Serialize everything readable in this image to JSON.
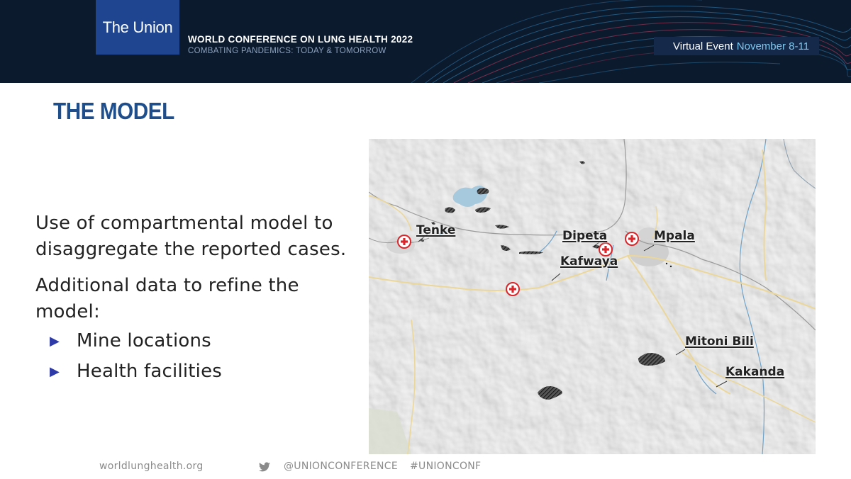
{
  "header": {
    "logo_text": "The Union",
    "conference_title": "WORLD CONFERENCE ON LUNG HEALTH 2022",
    "conference_subtitle": "COMBATING PANDEMICS: TODAY & TOMORROW",
    "event_label": "Virtual Event",
    "event_dates": "November 8-11",
    "colors": {
      "banner_bg": "#0c1a2e",
      "logo_bg": "#1f4590",
      "dates_accent": "#7fc7ee"
    }
  },
  "slide": {
    "title": "THE MODEL",
    "paragraph_1": "Use of compartmental model to disaggregate the reported cases.",
    "paragraph_2": "Additional data to refine the model:",
    "bullets": [
      "Mine locations",
      "Health facilities"
    ],
    "title_color": "#1f4e8c",
    "bullet_color": "#2d3aa8"
  },
  "map": {
    "towns": [
      "Tenke",
      "Dipeta",
      "Mpala",
      "Kafwaya",
      "Mitoni Bili",
      "Kakanda"
    ],
    "health_facility_icon": "red-cross-icon",
    "mine_icon": "hatched-mine-area",
    "health_facility_color": "#d9262b"
  },
  "footer": {
    "website": "worldlunghealth.org",
    "twitter_icon": "twitter-icon",
    "twitter_handle": "@UNIONCONFERENCE",
    "hashtag": "#UNIONCONF"
  }
}
